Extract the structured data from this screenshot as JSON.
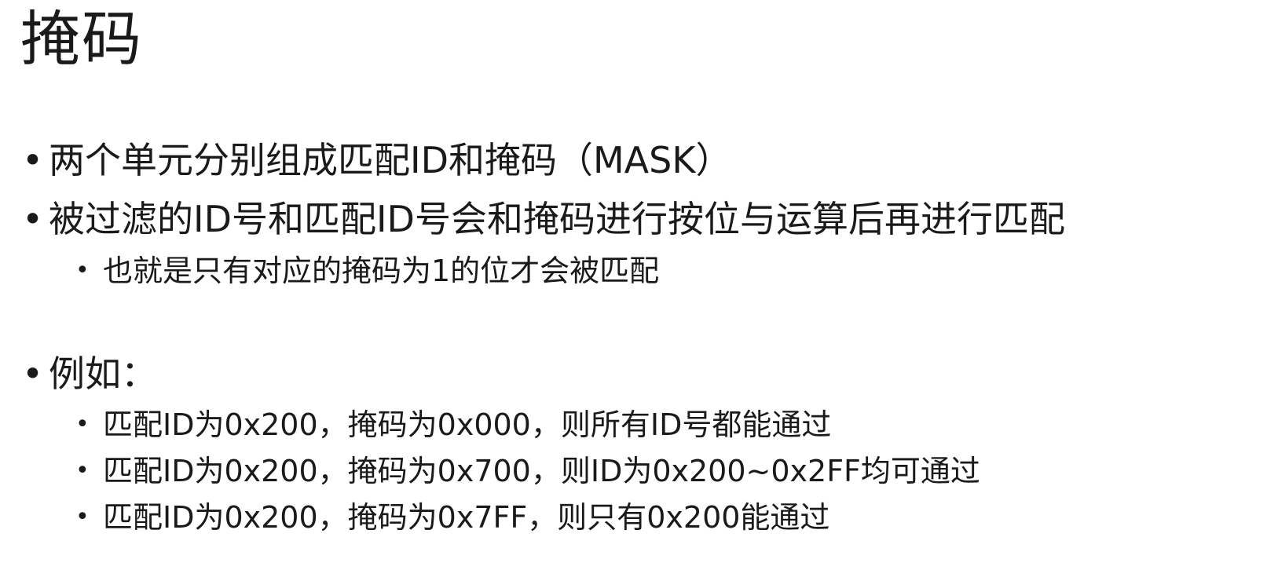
{
  "slide": {
    "title": "掩码",
    "bullet_glyph": "•",
    "items": [
      {
        "level": 1,
        "text": "两个单元分别组成匹配ID和掩码（MASK）"
      },
      {
        "level": 1,
        "text": "被过滤的ID号和匹配ID号会和掩码进行按位与运算后再进行匹配"
      },
      {
        "level": 2,
        "text": "也就是只有对应的掩码为1的位才会被匹配"
      },
      {
        "level": 1,
        "text": "例如："
      },
      {
        "level": 2,
        "text": "匹配ID为0x200，掩码为0x000，则所有ID号都能通过"
      },
      {
        "level": 2,
        "text": "匹配ID为0x200，掩码为0x700，则ID为0x200~0x2FF均可通过"
      },
      {
        "level": 2,
        "text": "匹配ID为0x200，掩码为0x7FF，则只有0x200能通过"
      }
    ]
  }
}
